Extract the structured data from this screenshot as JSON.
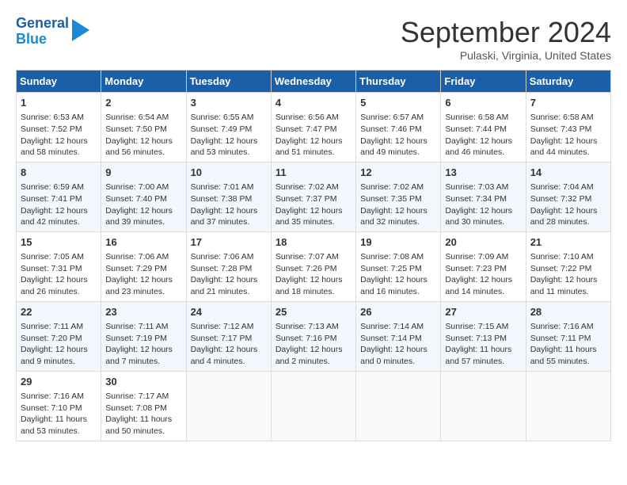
{
  "header": {
    "logo_line1": "General",
    "logo_line2": "Blue",
    "title": "September 2024",
    "subtitle": "Pulaski, Virginia, United States"
  },
  "columns": [
    "Sunday",
    "Monday",
    "Tuesday",
    "Wednesday",
    "Thursday",
    "Friday",
    "Saturday"
  ],
  "weeks": [
    [
      {
        "day": "1",
        "info": "Sunrise: 6:53 AM\nSunset: 7:52 PM\nDaylight: 12 hours and 58 minutes."
      },
      {
        "day": "2",
        "info": "Sunrise: 6:54 AM\nSunset: 7:50 PM\nDaylight: 12 hours and 56 minutes."
      },
      {
        "day": "3",
        "info": "Sunrise: 6:55 AM\nSunset: 7:49 PM\nDaylight: 12 hours and 53 minutes."
      },
      {
        "day": "4",
        "info": "Sunrise: 6:56 AM\nSunset: 7:47 PM\nDaylight: 12 hours and 51 minutes."
      },
      {
        "day": "5",
        "info": "Sunrise: 6:57 AM\nSunset: 7:46 PM\nDaylight: 12 hours and 49 minutes."
      },
      {
        "day": "6",
        "info": "Sunrise: 6:58 AM\nSunset: 7:44 PM\nDaylight: 12 hours and 46 minutes."
      },
      {
        "day": "7",
        "info": "Sunrise: 6:58 AM\nSunset: 7:43 PM\nDaylight: 12 hours and 44 minutes."
      }
    ],
    [
      {
        "day": "8",
        "info": "Sunrise: 6:59 AM\nSunset: 7:41 PM\nDaylight: 12 hours and 42 minutes."
      },
      {
        "day": "9",
        "info": "Sunrise: 7:00 AM\nSunset: 7:40 PM\nDaylight: 12 hours and 39 minutes."
      },
      {
        "day": "10",
        "info": "Sunrise: 7:01 AM\nSunset: 7:38 PM\nDaylight: 12 hours and 37 minutes."
      },
      {
        "day": "11",
        "info": "Sunrise: 7:02 AM\nSunset: 7:37 PM\nDaylight: 12 hours and 35 minutes."
      },
      {
        "day": "12",
        "info": "Sunrise: 7:02 AM\nSunset: 7:35 PM\nDaylight: 12 hours and 32 minutes."
      },
      {
        "day": "13",
        "info": "Sunrise: 7:03 AM\nSunset: 7:34 PM\nDaylight: 12 hours and 30 minutes."
      },
      {
        "day": "14",
        "info": "Sunrise: 7:04 AM\nSunset: 7:32 PM\nDaylight: 12 hours and 28 minutes."
      }
    ],
    [
      {
        "day": "15",
        "info": "Sunrise: 7:05 AM\nSunset: 7:31 PM\nDaylight: 12 hours and 26 minutes."
      },
      {
        "day": "16",
        "info": "Sunrise: 7:06 AM\nSunset: 7:29 PM\nDaylight: 12 hours and 23 minutes."
      },
      {
        "day": "17",
        "info": "Sunrise: 7:06 AM\nSunset: 7:28 PM\nDaylight: 12 hours and 21 minutes."
      },
      {
        "day": "18",
        "info": "Sunrise: 7:07 AM\nSunset: 7:26 PM\nDaylight: 12 hours and 18 minutes."
      },
      {
        "day": "19",
        "info": "Sunrise: 7:08 AM\nSunset: 7:25 PM\nDaylight: 12 hours and 16 minutes."
      },
      {
        "day": "20",
        "info": "Sunrise: 7:09 AM\nSunset: 7:23 PM\nDaylight: 12 hours and 14 minutes."
      },
      {
        "day": "21",
        "info": "Sunrise: 7:10 AM\nSunset: 7:22 PM\nDaylight: 12 hours and 11 minutes."
      }
    ],
    [
      {
        "day": "22",
        "info": "Sunrise: 7:11 AM\nSunset: 7:20 PM\nDaylight: 12 hours and 9 minutes."
      },
      {
        "day": "23",
        "info": "Sunrise: 7:11 AM\nSunset: 7:19 PM\nDaylight: 12 hours and 7 minutes."
      },
      {
        "day": "24",
        "info": "Sunrise: 7:12 AM\nSunset: 7:17 PM\nDaylight: 12 hours and 4 minutes."
      },
      {
        "day": "25",
        "info": "Sunrise: 7:13 AM\nSunset: 7:16 PM\nDaylight: 12 hours and 2 minutes."
      },
      {
        "day": "26",
        "info": "Sunrise: 7:14 AM\nSunset: 7:14 PM\nDaylight: 12 hours and 0 minutes."
      },
      {
        "day": "27",
        "info": "Sunrise: 7:15 AM\nSunset: 7:13 PM\nDaylight: 11 hours and 57 minutes."
      },
      {
        "day": "28",
        "info": "Sunrise: 7:16 AM\nSunset: 7:11 PM\nDaylight: 11 hours and 55 minutes."
      }
    ],
    [
      {
        "day": "29",
        "info": "Sunrise: 7:16 AM\nSunset: 7:10 PM\nDaylight: 11 hours and 53 minutes."
      },
      {
        "day": "30",
        "info": "Sunrise: 7:17 AM\nSunset: 7:08 PM\nDaylight: 11 hours and 50 minutes."
      },
      {
        "day": "",
        "info": ""
      },
      {
        "day": "",
        "info": ""
      },
      {
        "day": "",
        "info": ""
      },
      {
        "day": "",
        "info": ""
      },
      {
        "day": "",
        "info": ""
      }
    ]
  ]
}
